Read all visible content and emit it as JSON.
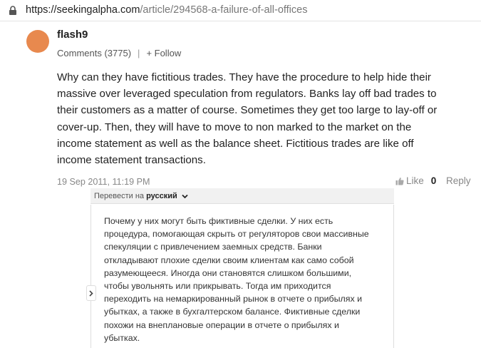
{
  "browser": {
    "url_host": "https://seekingalpha.com",
    "url_path": "/article/294568-a-failure-of-all-offices",
    "lock_icon": "lock-icon"
  },
  "comment": {
    "avatar_color": "#e8894e",
    "username": "flash9",
    "comments_label": "Comments (3775)",
    "separator": "|",
    "follow_label": "+ Follow",
    "body_lines": [
      "Why can they have fictitious trades. They have the procedure to help hide their",
      "massive over leveraged speculation from regulators. Banks lay off bad trades to",
      "their customers as a matter of course. Sometimes they get too large to lay-off or",
      "cover-up. Then, they will have to move to non marked to the market on the",
      "income statement as well as the balance sheet. Fictitious trades are like off",
      "income statement transactions."
    ],
    "date": "19 Sep 2011, 11:19 PM",
    "like_label": "Like",
    "like_count": "0",
    "reply_label": "Reply"
  },
  "translate": {
    "prefix": "Перевести на",
    "language": "русский",
    "lines": [
      "Почему у них могут быть фиктивные сделки. У них есть",
      "процедура, помогающая скрыть от регуляторов свои массивные",
      "спекуляции с привлечением заемных средств. Банки",
      "откладывают плохие сделки своим клиентам как само собой",
      "разумеющееся. Иногда они становятся слишком большими,",
      "чтобы увольнять или прикрывать. Тогда им приходится",
      "переходить на немаркированный рынок в отчете о прибылях и",
      "убытках, а также в бухгалтерском балансе. Фиктивные сделки",
      "похожи на внеплановые операции в отчете о прибылях и",
      "убытках."
    ]
  }
}
